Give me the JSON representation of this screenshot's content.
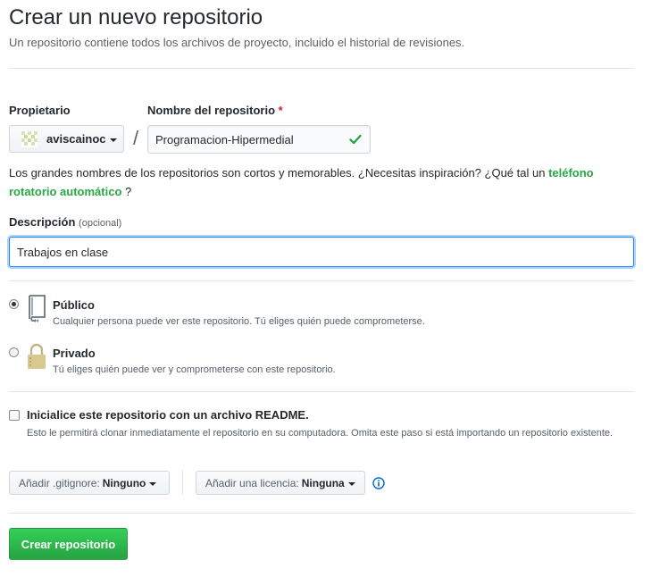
{
  "header": {
    "title": "Crear un nuevo repositorio",
    "subtitle": "Un repositorio contiene todos los archivos de proyecto, incluido el historial de revisiones."
  },
  "owner": {
    "label": "Propietario",
    "value": "aviscainoc",
    "avatar_icon": "identicon-avatar"
  },
  "repo_name": {
    "label": "Nombre del repositorio",
    "required_marker": "*",
    "separator": "/",
    "value": "Programacion-Hipermedial",
    "status_icon": "check-icon",
    "status_color": "#28a745"
  },
  "hint": {
    "text_before": "Los grandes nombres de los repositorios son cortos y memorables. ¿Necesitas inspiración? ¿Qué tal un ",
    "suggestion": "teléfono rotatorio automático",
    "text_after": " ?"
  },
  "description": {
    "label": "Descripción",
    "optional": "(opcional)",
    "value": "Trabajos en clase"
  },
  "visibility": {
    "public": {
      "title": "Público",
      "note": "Cualquier persona puede ver este repositorio. Tú eliges quién puede comprometerse.",
      "checked": true,
      "icon": "repo-book-icon"
    },
    "private": {
      "title": "Privado",
      "note": "Tú eliges quién puede ver y comprometerse con este repositorio.",
      "checked": false,
      "icon": "lock-icon"
    }
  },
  "readme": {
    "label": "Inicialice este repositorio con un archivo README.",
    "note": "Esto le permitirá clonar inmediatamente el repositorio en su computadora. Omita este paso si está importando un repositorio existente.",
    "checked": false
  },
  "gitignore": {
    "label": "Añadir .gitignore:",
    "value": "Ninguno"
  },
  "license": {
    "label": "Añadir una licencia:",
    "value": "Ninguna",
    "info_icon": "info-icon"
  },
  "submit": {
    "label": "Crear repositorio",
    "color": "#28a745"
  }
}
